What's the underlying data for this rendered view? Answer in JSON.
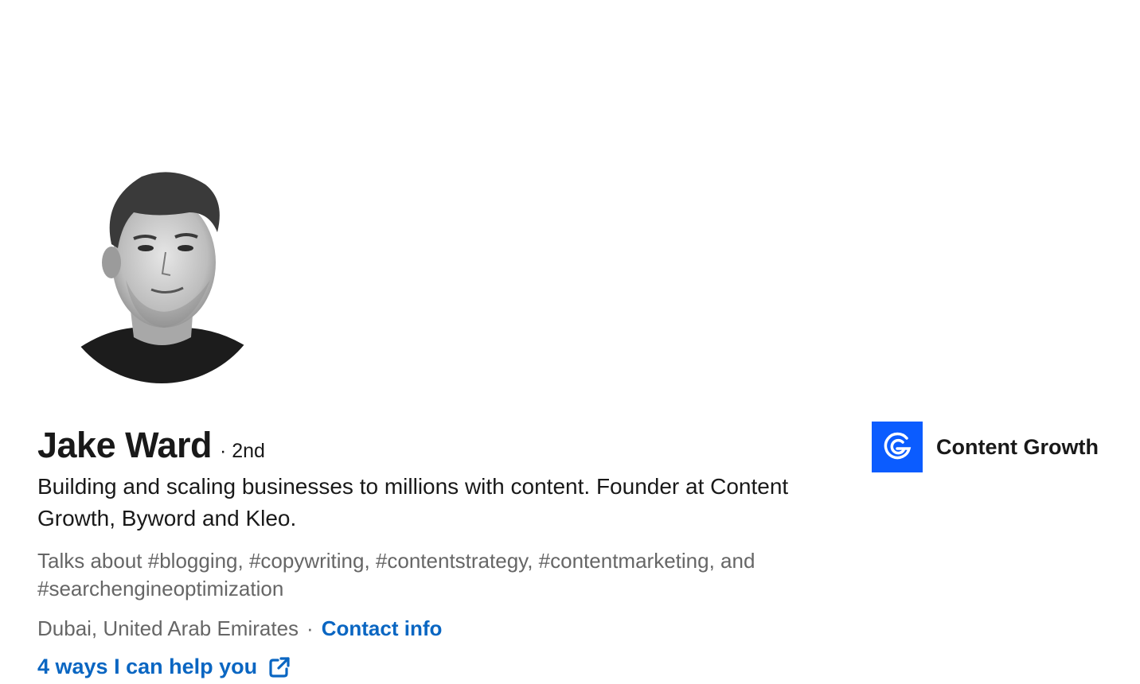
{
  "profile": {
    "name": "Jake Ward",
    "degree": "· 2nd",
    "headline": "Building and scaling businesses to millions with content. Founder at Content Growth, Byword and Kleo.",
    "talks_about": "Talks about #blogging, #copywriting, #contentstrategy, #contentmarketing, and #searchengineoptimization",
    "location": "Dubai, United Arab Emirates",
    "separator": "·",
    "contact_info": "Contact info",
    "help_link": "4 ways I can help you"
  },
  "company": {
    "name": "Content Growth",
    "logo_color": "#0b5cff"
  },
  "colors": {
    "link": "#0a66c2",
    "secondary_text": "#666666",
    "primary_text": "#191919"
  },
  "icons": {
    "avatar": "profile-photo",
    "external": "external-link-icon",
    "company_logo": "content-growth-logo"
  }
}
